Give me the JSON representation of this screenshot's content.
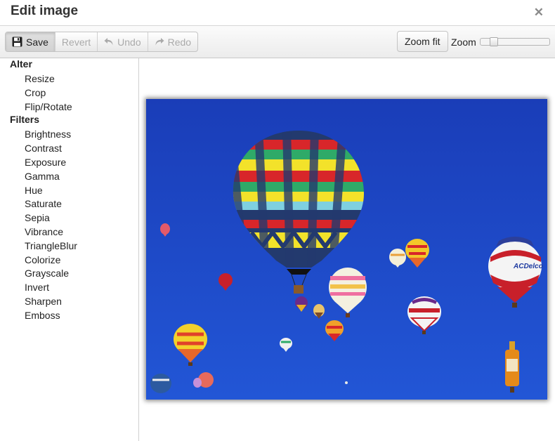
{
  "dialog": {
    "title": "Edit image",
    "close_glyph": "✕"
  },
  "toolbar": {
    "save": "Save",
    "revert": "Revert",
    "undo": "Undo",
    "redo": "Redo",
    "zoom_fit": "Zoom fit",
    "zoom_label": "Zoom",
    "zoom_value": 0.15
  },
  "sidebar": {
    "groups": [
      {
        "title": "Alter",
        "items": [
          "Resize",
          "Crop",
          "Flip/Rotate"
        ]
      },
      {
        "title": "Filters",
        "items": [
          "Brightness",
          "Contrast",
          "Exposure",
          "Gamma",
          "Hue",
          "Saturate",
          "Sepia",
          "Vibrance",
          "TriangleBlur",
          "Colorize",
          "Grayscale",
          "Invert",
          "Sharpen",
          "Emboss"
        ]
      }
    ]
  },
  "image": {
    "description_subject": "hot-air-balloons",
    "sky_color": "#1f46c8",
    "balloon_text": "ACDelco"
  },
  "colors": {
    "accent": "#1f46c8",
    "toolbar_bg": "#ececec"
  }
}
